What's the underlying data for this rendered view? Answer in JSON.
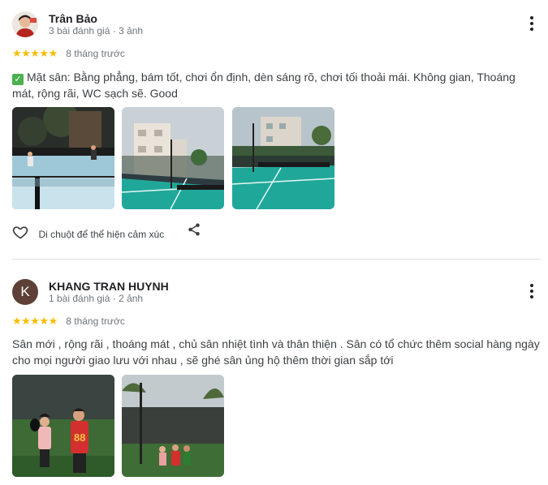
{
  "reviews": [
    {
      "name": "Trân Bảo",
      "meta": "3 bài đánh giá · 3 ảnh",
      "stars": "★★★★★",
      "time": "8 tháng trước",
      "text": "Mặt sân: Bằng phẳng, bám tốt, chơi ổn định, dèn sáng rõ, chơi tối thoải mái. Không gian, Thoáng mát, rộng rãi, WC sạch sẽ. Good",
      "react_label": "Di chuột để thể hiện cảm xúc"
    },
    {
      "name": "KHANG TRAN HUYNH",
      "avatar_letter": "K",
      "meta": "1 bài đánh giá · 2 ảnh",
      "stars": "★★★★★",
      "time": "8 tháng trước",
      "text": "Sân mới , rộng rãi , thoáng mát , chủ sân nhiệt tình và thân thiện . Sân có tổ chức thêm social hàng ngày cho mọi người giao lưu với nhau , sẽ ghé sân ủng hộ thêm thời gian sắp tới"
    }
  ],
  "colors": {
    "star": "#fbbc04",
    "court_teal": "#1fa89a",
    "avatar_k": "#5d4037"
  },
  "icons": [
    "more-vert-icon",
    "check-box-icon",
    "heart-icon",
    "share-icon"
  ]
}
